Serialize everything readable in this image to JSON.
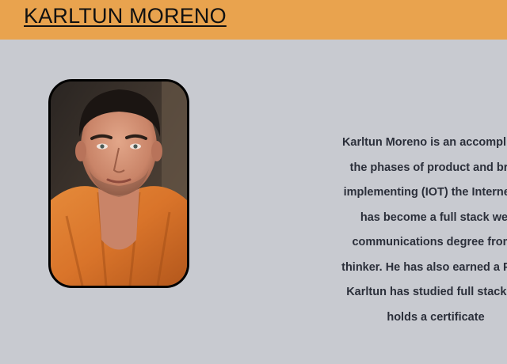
{
  "header": {
    "site_title": "KARLTUN MORENO"
  },
  "profile": {
    "photo_alt": "Portrait of Karltun Moreno"
  },
  "bio": {
    "lines": [
      "Karltun Moreno is an accomplishe",
      "the phases of product and bran",
      "implementing (IOT) the Internet of",
      "has become a full stack wel",
      "communications degree from l",
      "thinker. He has also earned a Psyc",
      "Karltun has studied full stack we",
      "holds a certificate"
    ]
  },
  "colors": {
    "header_bg": "#e9a34e",
    "page_bg": "#c8cad0",
    "text": "#2b2f3a"
  }
}
